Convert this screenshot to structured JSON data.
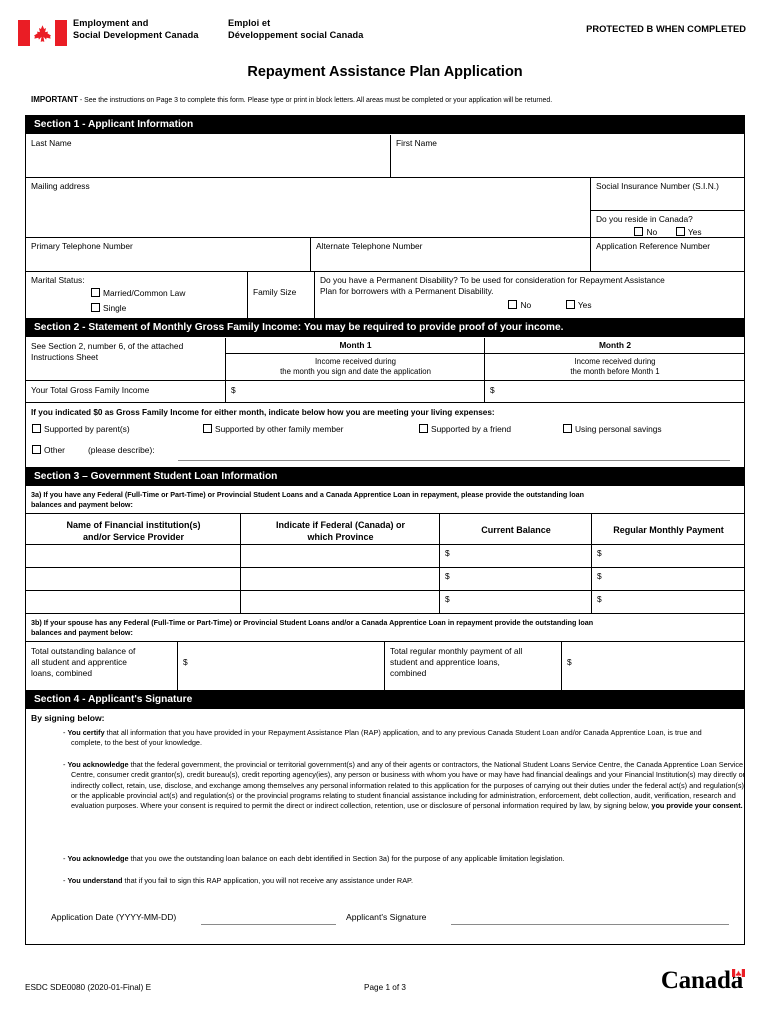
{
  "header": {
    "flag_icon": "canada-flag-icon",
    "dept_en_line1": "Employment and",
    "dept_en_line2": "Social Development Canada",
    "dept_fr_line1": "Emploi et",
    "dept_fr_line2": "Développement social Canada",
    "protected": "PROTECTED B WHEN COMPLETED"
  },
  "title": "Repayment Assistance Plan Application",
  "important": {
    "label": "IMPORTANT",
    "text": " - See the instructions on Page 3 to complete this form. Please type or print in block letters. All areas must be completed or your application will be returned."
  },
  "section1": {
    "heading": "Section 1 - Applicant Information",
    "last_name": "Last Name",
    "first_name": "First Name",
    "mailing_address": "Mailing address",
    "sin": "Social Insurance Number (S.I.N.)",
    "reside_question": "Do you reside in Canada?",
    "reside_no": "No",
    "reside_yes": "Yes",
    "primary_phone": "Primary Telephone Number",
    "alternate_phone": "Alternate Telephone Number",
    "app_ref": "Application Reference Number",
    "marital_status": "Marital Status:",
    "married": "Married/Common Law",
    "single": "Single",
    "family_size": "Family Size",
    "disability_line1": "Do you have a Permanent Disability? To be used for consideration for Repayment Assistance",
    "disability_line2": "Plan for borrowers with a Permanent Disability.",
    "disability_no": "No",
    "disability_yes": "Yes"
  },
  "section2": {
    "heading": "Section 2 - Statement of Monthly Gross Family Income: You may be required to provide proof of your income.",
    "see_instructions_line1": "See Section 2, number 6, of the attached",
    "see_instructions_line2": "Instructions Sheet",
    "month1": "Month 1",
    "month2": "Month 2",
    "month1_desc_line1": "Income received during",
    "month1_desc_line2": "the month you sign and date the application",
    "month2_desc_line1": "Income received during",
    "month2_desc_line2": "the month before Month 1",
    "total_income_label": "Your Total Gross Family Income",
    "dollar": "$",
    "zero_income_prompt": "If you indicated $0 as Gross Family Income for either month, indicate below how you are meeting your living expenses:",
    "opt_parents": "Supported by parent(s)",
    "opt_family": "Supported by other family member",
    "opt_friend": "Supported by a friend",
    "opt_savings": "Using personal savings",
    "opt_other": "Other",
    "opt_other_desc": "(please describe):"
  },
  "section3": {
    "heading": "Section 3 – Government Student Loan Information",
    "q3a_line1": "3a) If you have any Federal (Full-Time or Part-Time) or Provincial Student Loans and a Canada Apprentice Loan in repayment, please provide the outstanding loan",
    "q3a_line2": "balances and payment below:",
    "col_name_line1": "Name of Financial institution(s)",
    "col_name_line2": "and/or Service Provider",
    "col_fed_line1": "Indicate if Federal (Canada) or",
    "col_fed_line2": "which Province",
    "col_balance": "Current Balance",
    "col_payment": "Regular Monthly Payment",
    "rows": [
      {
        "name": "",
        "province": "",
        "balance": "$",
        "payment": "$"
      },
      {
        "name": "",
        "province": "",
        "balance": "$",
        "payment": "$"
      },
      {
        "name": "",
        "province": "",
        "balance": "$",
        "payment": "$"
      }
    ],
    "q3b_line1": "3b) If your spouse has any Federal (Full-Time or Part-Time) or Provincial Student Loans and/or a Canada Apprentice Loan in repayment provide the outstanding loan",
    "q3b_line2": "balances and payment below:",
    "total_balance_line1": "Total outstanding balance of",
    "total_balance_line2": "all student and apprentice",
    "total_balance_line3": "loans, combined",
    "total_balance_value": "$",
    "total_payment_line1": "Total regular monthly payment of all",
    "total_payment_line2": "student and apprentice loans,",
    "total_payment_line3": "combined",
    "total_payment_value": "$"
  },
  "section4": {
    "heading": "Section 4 - Applicant's Signature",
    "by_signing": "By signing below:",
    "clauses": [
      {
        "lead": "You certify",
        "body": " that all information that you have provided in your Repayment Assistance Plan (RAP) application, and to any previous Canada Student Loan and/or Canada Apprentice Loan, is true and complete, to the best of your knowledge."
      },
      {
        "lead": "You acknowledge",
        "body": " that the federal government, the provincial or territorial government(s) and any of their agents or contractors, the National Student Loans Service Centre, the Canada Apprentice Loan Service Centre, consumer credit grantor(s), credit bureau(s), credit reporting agency(ies), any person or business with whom you have or may have had financial dealings and your Financial Institution(s) may directly or indirectly collect, retain, use, disclose, and exchange among themselves any personal information related to this application for the purposes of carrying out their duties under the federal act(s) and regulation(s) or the applicable provincial act(s) and regulation(s) or the provincial programs relating to student financial assistance including for administration, enforcement, debt collection, audit, verification, research and evaluation purposes. Where your consent is required to permit the direct or indirect collection, retention, use or disclosure of personal information required by law, by signing below, ",
        "tail_bold": "you provide your consent."
      },
      {
        "lead": "You acknowledge",
        "body": " that you owe the outstanding loan balance on each debt identified in Section 3a) for the purpose of any applicable limitation legislation."
      },
      {
        "lead": "You understand",
        "body": " that if you fail to sign this RAP application, you will not receive any assistance under RAP."
      }
    ],
    "application_date_label": "Application Date (YYYY-MM-DD)",
    "signature_label": "Applicant's Signature",
    "application_date_value": "",
    "signature_value": ""
  },
  "footer": {
    "form_code": "ESDC SDE0080 (2020-01-Final) E",
    "page": "Page 1 of 3",
    "wordmark": "Canada"
  },
  "colors": {
    "flag_red": "#EA1D25",
    "bar_bg": "#000000",
    "bar_text": "#FFFFFF",
    "rule": "#8A8A8A"
  }
}
